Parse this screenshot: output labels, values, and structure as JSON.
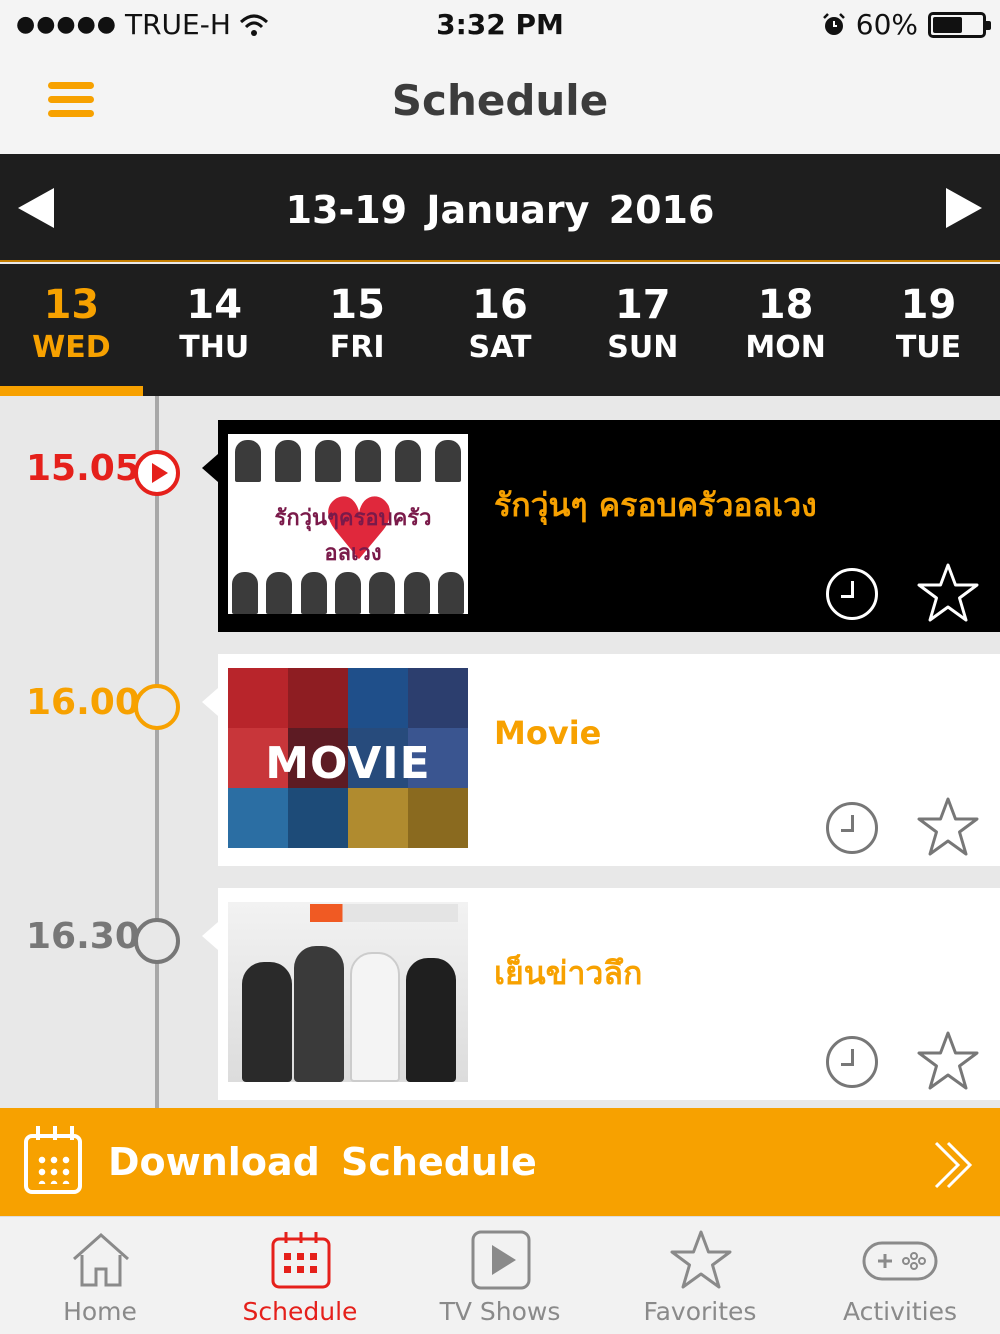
{
  "status_bar": {
    "carrier": "TRUE-H",
    "time": "3:32 PM",
    "battery": "60%",
    "battery_level": 0.6
  },
  "header": {
    "title": "Schedule",
    "menu_icon": "hamburger-icon"
  },
  "week": {
    "range": "13-19  January  2016",
    "prev_icon": "triangle-left-icon",
    "next_icon": "triangle-right-icon"
  },
  "days": [
    {
      "num": "13",
      "dow": "WED",
      "active": true
    },
    {
      "num": "14",
      "dow": "THU"
    },
    {
      "num": "15",
      "dow": "FRI"
    },
    {
      "num": "16",
      "dow": "SAT"
    },
    {
      "num": "17",
      "dow": "SUN"
    },
    {
      "num": "18",
      "dow": "MON"
    },
    {
      "num": "19",
      "dow": "TUE"
    }
  ],
  "schedule": [
    {
      "time": "15.05",
      "title": "รักวุ่นๆ ครอบครัวอลเวง",
      "state": "now",
      "thumb_text": "รักวุ่นๆครอบครัว อลเวง"
    },
    {
      "time": "16.00",
      "title": "Movie",
      "state": "next",
      "thumb_text": "MOVIE"
    },
    {
      "time": "16.30",
      "title": "เย็นข่าวลึก",
      "state": "later"
    }
  ],
  "download": {
    "label": "Download  Schedule",
    "icon": "calendar-icon"
  },
  "tabs": [
    {
      "label": "Home",
      "icon": "home-icon"
    },
    {
      "label": "Schedule",
      "icon": "calendar-icon",
      "active": true
    },
    {
      "label": "TV Shows",
      "icon": "play-icon"
    },
    {
      "label": "Favorites",
      "icon": "star-icon"
    },
    {
      "label": "Activities",
      "icon": "gamepad-icon"
    }
  ],
  "colors": {
    "accent": "#f7a100",
    "live": "#e5201b",
    "dark": "#1e1e1e"
  }
}
